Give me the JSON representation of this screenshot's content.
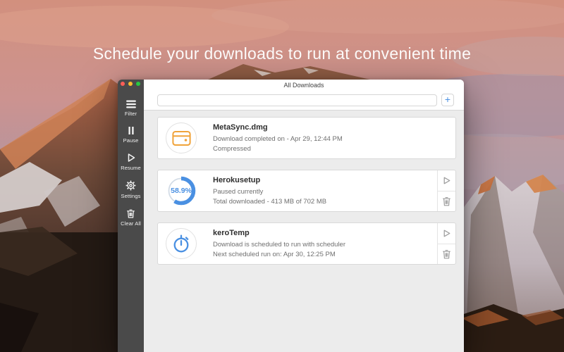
{
  "headline": "Schedule your downloads to run at convenient time",
  "window": {
    "title": "All Downloads",
    "sidebar": {
      "items": [
        {
          "label": "Filter",
          "icon": "filter-icon"
        },
        {
          "label": "Pause",
          "icon": "pause-icon"
        },
        {
          "label": "Resume",
          "icon": "play-icon"
        },
        {
          "label": "Settings",
          "icon": "gear-icon"
        },
        {
          "label": "Clear All",
          "icon": "trash-icon"
        }
      ]
    },
    "toolbar": {
      "search_value": "",
      "search_placeholder": "",
      "add_button": "+"
    },
    "downloads": [
      {
        "name": "MetaSync.dmg",
        "line1": "Download completed on - Apr 29, 12:44 PM",
        "line2": "Compressed",
        "icon": "disk-image-icon",
        "icon_color": "#f0a33a",
        "actions": []
      },
      {
        "name": "Herokusetup",
        "line1": "Paused currently",
        "line2": "Total downloaded - 413 MB of 702 MB",
        "progress_percent": "58.9%",
        "progress_value": 58.9,
        "accent": "#4a90e2",
        "actions": [
          "resume",
          "delete"
        ]
      },
      {
        "name": "keroTemp",
        "line1": "Download is scheduled to run with scheduler",
        "line2": "Next scheduled run on: Apr 30, 12:25 PM",
        "icon": "stopwatch-icon",
        "icon_color": "#4a90e2",
        "actions": [
          "resume",
          "delete"
        ]
      }
    ]
  },
  "colors": {
    "accent_blue": "#4a90e2",
    "icon_orange": "#f0a33a",
    "sidebar_gray": "#4a4a4a",
    "content_gray": "#ececec",
    "traffic_red": "#ff5f57",
    "traffic_yellow": "#febc2e",
    "traffic_green": "#28c840"
  }
}
